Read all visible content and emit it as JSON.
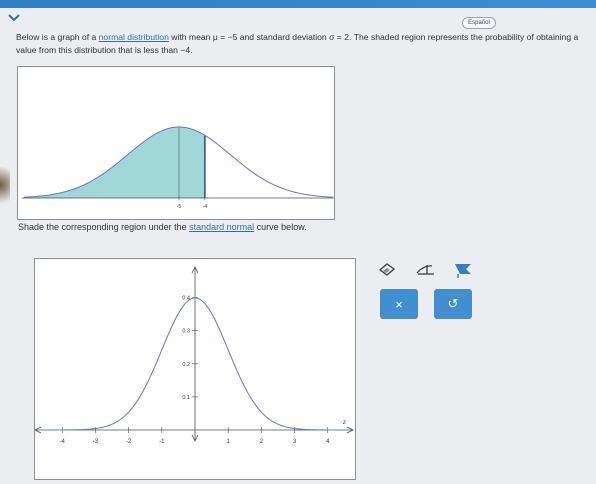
{
  "language_button": "Español",
  "question": {
    "part1": "Below is a graph of a ",
    "link": "normal distribution",
    "part2": " with mean μ = −5 and standard deviation σ = 2. The shaded region represents the probability of obtaining a value from this distribution that is less than −4."
  },
  "prompt": {
    "part1": "Shade the corresponding region under the ",
    "link": "standard normal",
    "part2": " curve below."
  },
  "colors": {
    "accent": "#3f8fd1",
    "shade": "#8fd1d0",
    "curve": "#6f6fd8"
  },
  "chart_data": [
    {
      "type": "area",
      "mean": -5,
      "sd": 2,
      "shaded_below": -4,
      "xlim": [
        -11,
        1
      ],
      "tick_labels": [
        "-5",
        "-4"
      ],
      "ticks": [
        -5,
        -4
      ]
    },
    {
      "type": "line",
      "mean": 0,
      "sd": 1,
      "xlim": [
        -4.7,
        4.7
      ],
      "ylim": [
        0,
        0.45
      ],
      "xticks": [
        -4,
        -3,
        -2,
        -1,
        1,
        2,
        3,
        4
      ],
      "xtick_labels": [
        "-4",
        "-3",
        "-2",
        "-1",
        "1",
        "2",
        "3",
        "4"
      ],
      "yticks": [
        0.1,
        0.2,
        0.3,
        0.4
      ],
      "ytick_labels": [
        "0.1",
        "0.2",
        "0.3",
        "0.4"
      ],
      "x_axis_label": "z"
    }
  ],
  "tools": {
    "icons": [
      "eraser-icon",
      "region-icon",
      "shade-icon"
    ],
    "clear_symbol": "×",
    "undo_symbol": "↺"
  }
}
